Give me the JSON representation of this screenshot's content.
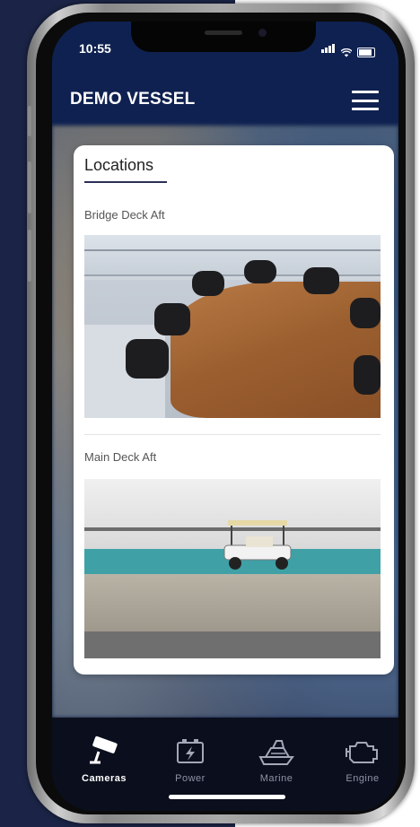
{
  "status_bar": {
    "time": "10:55"
  },
  "header": {
    "title": "DEMO VESSEL",
    "menu_icon": "hamburger-menu-icon"
  },
  "card": {
    "title": "Locations",
    "locations": [
      {
        "label": "Bridge Deck Aft"
      },
      {
        "label": "Main Deck Aft"
      }
    ]
  },
  "tabs": [
    {
      "label": "Cameras",
      "icon": "cctv-camera-icon",
      "active": true
    },
    {
      "label": "Power",
      "icon": "battery-power-icon",
      "active": false
    },
    {
      "label": "Marine",
      "icon": "yacht-icon",
      "active": false
    },
    {
      "label": "Engine",
      "icon": "engine-icon",
      "active": false
    }
  ],
  "colors": {
    "header_bg": "#0f2150",
    "page_bg_left": "#1b2446",
    "tabbar_bg": "#0b0f1d",
    "title_underline": "#2b2f55"
  }
}
